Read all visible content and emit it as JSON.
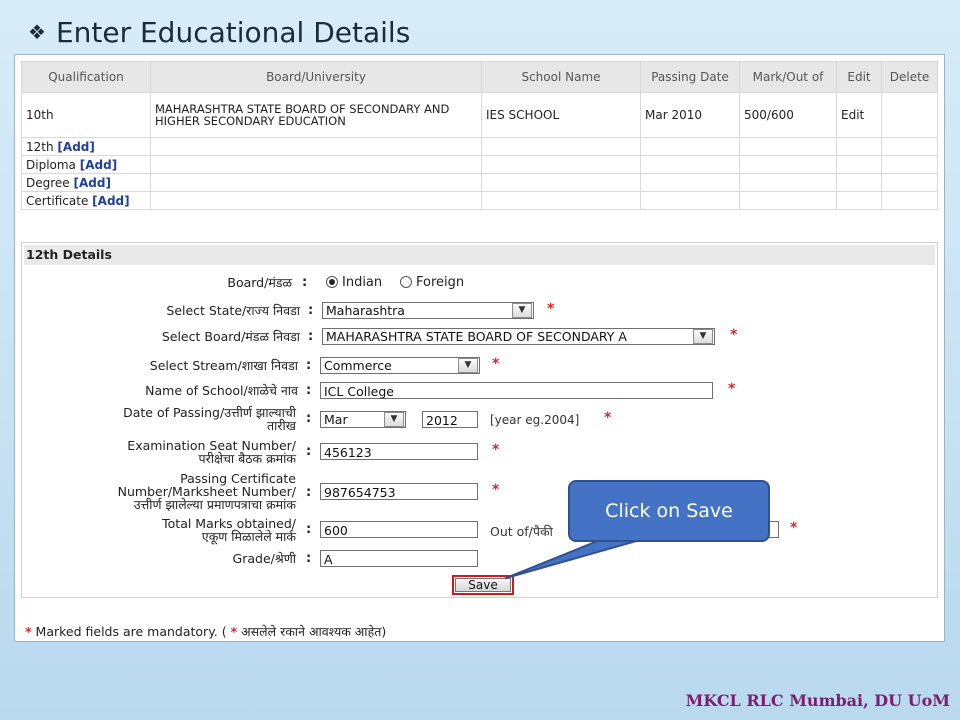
{
  "slide": {
    "title": "Enter Educational Details",
    "footer": "MKCL RLC Mumbai, DU UoM",
    "callout": "Click on Save"
  },
  "qual_table": {
    "headers": [
      "Qualification",
      "Board/University",
      "School Name",
      "Passing Date",
      "Mark/Out of",
      "Edit",
      "Delete"
    ],
    "row10": {
      "qualification": "10th",
      "board": "MAHARASHTRA STATE BOARD OF SECONDARY AND HIGHER SECONDARY EDUCATION",
      "school": "IES SCHOOL",
      "passing_date": "Mar 2010",
      "marks": "500/600",
      "edit": "Edit"
    },
    "add_rows": [
      {
        "label": "12th",
        "link": "[Add]"
      },
      {
        "label": "Diploma",
        "link": "[Add]"
      },
      {
        "label": "Degree",
        "link": "[Add]"
      },
      {
        "label": "Certificate",
        "link": "[Add]"
      }
    ]
  },
  "details": {
    "heading": "12th Details",
    "board_label": "Board/मंडळ",
    "board_options": [
      "Indian",
      "Foreign"
    ],
    "state_label": "Select State/राज्य निवडा",
    "state_value": "Maharashtra",
    "sboard_label": "Select Board/मंडळ निवडा",
    "sboard_value": "MAHARASHTRA STATE BOARD OF SECONDARY A",
    "stream_label": "Select Stream/शाखा निवडा",
    "stream_value": "Commerce",
    "school_label": "Name of School/शाळेचे नाव",
    "school_value": "ICL College",
    "date_label_1": "Date of Passing/उत्तीर्ण झाल्याची",
    "date_label_2": "तारीख",
    "month_value": "Mar",
    "year_value": "2012",
    "year_hint": "[year eg.2004]",
    "seat_label_1": "Examination Seat Number/",
    "seat_label_2": "परीक्षेचा बैठक क्रमांक",
    "seat_value": "456123",
    "cert_label_1": "Passing Certificate",
    "cert_label_2": "Number/Marksheet Number/",
    "cert_label_3": "उत्तीर्ण झालेल्या प्रमाणपत्राचा क्रमांक",
    "cert_value": "987654753",
    "marks_label_1": "Total Marks obtained/",
    "marks_label_2": "एकूण मिळालेले मार्क",
    "marks_value": "600",
    "outof_label": "Out of/पैकी",
    "grade_label": "Grade/श्रेणी",
    "grade_value": "A",
    "save_label": "Save",
    "colon": ":",
    "star": "*"
  },
  "mandatory": {
    "pre": "Marked fields are mandatory. (",
    "post": "असलेले रकाने आवश्यक आहेत)"
  },
  "colors": {
    "accent": "#4472c4",
    "required": "#e0242a",
    "link": "#1f3f9a"
  }
}
